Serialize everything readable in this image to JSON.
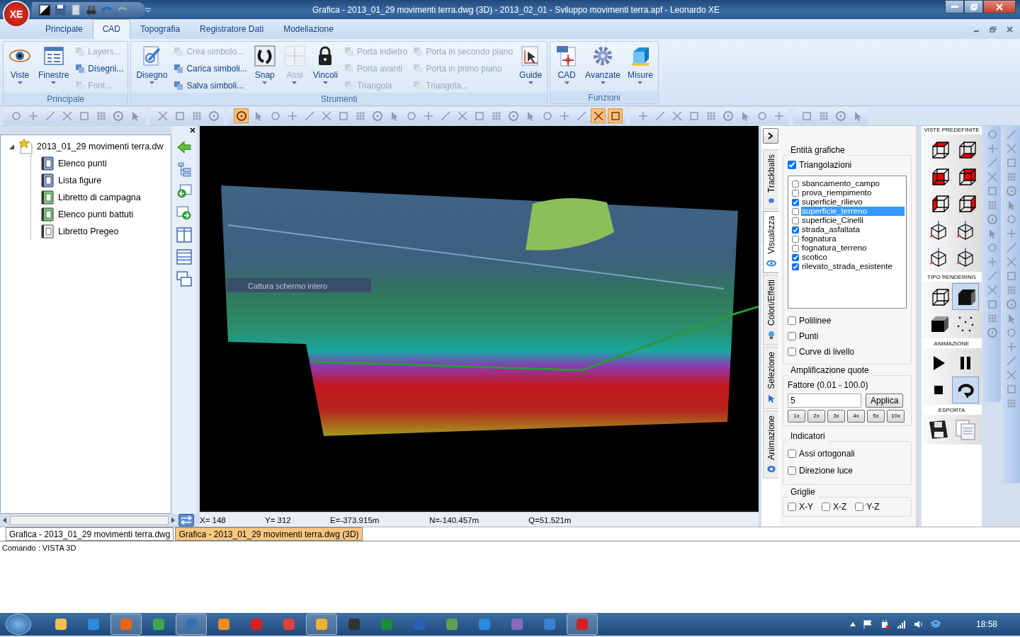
{
  "title_bar": {
    "title": "Grafica - 2013_01_29 movimenti terra.dwg (3D) - 2013_02_01 - Sviluppo movimenti terra.apf - Leonardo XE"
  },
  "app_button": {
    "label": "XE"
  },
  "ribbon": {
    "tabs": [
      {
        "label": "Principale",
        "selected": false
      },
      {
        "label": "CAD",
        "selected": true
      },
      {
        "label": "Topografia",
        "selected": false
      },
      {
        "label": "Registratore Dati",
        "selected": false
      },
      {
        "label": "Modellazione",
        "selected": false
      }
    ],
    "groups": [
      {
        "label": "Principale",
        "items": [
          {
            "kind": "large",
            "label": "Viste",
            "disabled": false
          },
          {
            "kind": "large",
            "label": "Finestre",
            "disabled": false
          },
          {
            "kind": "small",
            "label": "Layers...",
            "disabled": true
          },
          {
            "kind": "small",
            "label": "Disegni...",
            "disabled": false
          },
          {
            "kind": "small",
            "label": "Font...",
            "disabled": true
          }
        ]
      },
      {
        "label": "Strumenti",
        "items": [
          {
            "kind": "large",
            "label": "Disegno",
            "disabled": false
          },
          {
            "kind": "small",
            "label": "Crea simbolo...",
            "disabled": true
          },
          {
            "kind": "small",
            "label": "Carica simboli...",
            "disabled": false
          },
          {
            "kind": "small",
            "label": "Salva simboli...",
            "disabled": false
          },
          {
            "kind": "large",
            "label": "Snap",
            "disabled": false
          },
          {
            "kind": "large",
            "label": "Assi",
            "disabled": true
          },
          {
            "kind": "large",
            "label": "Vincoli",
            "disabled": false
          },
          {
            "kind": "small",
            "label": "Porta indietro",
            "disabled": true
          },
          {
            "kind": "small",
            "label": "Porta avanti",
            "disabled": true
          },
          {
            "kind": "small",
            "label": "Triangola",
            "disabled": true
          },
          {
            "kind": "small",
            "label": "Porta in secondo piano",
            "disabled": true
          },
          {
            "kind": "small",
            "label": "Porta in primo piano",
            "disabled": true
          },
          {
            "kind": "small",
            "label": "Triangola...",
            "disabled": true
          },
          {
            "kind": "large",
            "label": "Guide",
            "disabled": false
          }
        ]
      },
      {
        "label": "Funzioni",
        "items": [
          {
            "kind": "large",
            "label": "CAD",
            "disabled": false
          },
          {
            "kind": "large",
            "label": "Avanzate",
            "disabled": false
          },
          {
            "kind": "large",
            "label": "Misure",
            "disabled": false
          }
        ]
      }
    ]
  },
  "toolbars": [
    {
      "buttons": [
        {
          "pressed": false
        },
        {
          "pressed": false
        },
        {
          "pressed": false
        },
        {
          "pressed": false
        },
        {
          "pressed": false
        },
        {
          "pressed": false
        },
        {
          "pressed": false
        },
        {
          "pressed": false
        }
      ]
    },
    {
      "buttons": [
        {
          "pressed": false
        },
        {
          "pressed": false
        },
        {
          "pressed": false
        },
        {
          "pressed": false
        }
      ]
    },
    {
      "buttons": [
        {
          "pressed": true
        },
        {
          "pressed": false
        },
        {
          "pressed": false
        },
        {
          "pressed": false
        },
        {
          "pressed": false
        },
        {
          "pressed": false
        },
        {
          "pressed": false
        },
        {
          "pressed": false
        },
        {
          "pressed": false
        },
        {
          "pressed": false
        },
        {
          "pressed": false
        },
        {
          "pressed": false
        },
        {
          "pressed": false
        },
        {
          "pressed": false
        },
        {
          "pressed": false
        },
        {
          "pressed": false
        },
        {
          "pressed": false
        },
        {
          "pressed": false
        },
        {
          "pressed": false
        },
        {
          "pressed": false
        },
        {
          "pressed": false
        },
        {
          "pressed": true
        },
        {
          "pressed": true
        }
      ]
    },
    {
      "buttons": [
        {
          "pressed": false
        },
        {
          "pressed": false
        },
        {
          "pressed": false
        },
        {
          "pressed": false
        },
        {
          "pressed": false
        },
        {
          "pressed": false
        },
        {
          "pressed": false
        },
        {
          "pressed": false
        },
        {
          "pressed": false
        }
      ]
    },
    {
      "buttons": [
        {
          "pressed": false
        },
        {
          "pressed": false
        },
        {
          "pressed": false
        },
        {
          "pressed": false
        }
      ]
    }
  ],
  "tree": {
    "label": "2013_01_29 movimenti terra.dw",
    "expanded": true,
    "children": [
      {
        "label": "Elenco punti"
      },
      {
        "label": "Lista figure"
      },
      {
        "label": "Libretto di campagna"
      },
      {
        "label": "Elenco punti battuti"
      },
      {
        "label": "Libretto Pregeo"
      }
    ]
  },
  "viewport": {
    "hint": "Cattura schermo intero"
  },
  "side_tabs": [
    {
      "label": "Trackballs",
      "selected": false
    },
    {
      "label": "Visualizza",
      "selected": true
    },
    {
      "label": "Colori/Effetti",
      "selected": false
    },
    {
      "label": "Selezione",
      "selected": false
    },
    {
      "label": "Animazione",
      "selected": false
    }
  ],
  "view_panel": {
    "entities": {
      "title": "Entità grafiche",
      "triangulations": {
        "label": "Triangolazioni",
        "checked": true
      },
      "layers": [
        {
          "label": "sbancamento_campo",
          "checked": false,
          "selected": false
        },
        {
          "label": "prova_riempimento",
          "checked": false,
          "selected": false
        },
        {
          "label": "superficie_rilievo",
          "checked": true,
          "selected": false
        },
        {
          "label": "superficie_terreno",
          "checked": false,
          "selected": true
        },
        {
          "label": "superficie_Cinelli",
          "checked": false,
          "selected": false
        },
        {
          "label": "strada_asfaltata",
          "checked": true,
          "selected": false
        },
        {
          "label": "fognatura",
          "checked": false,
          "selected": false
        },
        {
          "label": "fognatura_terreno",
          "checked": false,
          "selected": false
        },
        {
          "label": "scotico",
          "checked": true,
          "selected": false
        },
        {
          "label": "rilevato_strada_esistente",
          "checked": true,
          "selected": false
        }
      ],
      "options": [
        {
          "label": "Polilinee",
          "checked": false
        },
        {
          "label": "Punti",
          "checked": false
        },
        {
          "label": "Curve di livello",
          "checked": false
        }
      ]
    },
    "amplification": {
      "title": "Amplificazione quote",
      "factor_label": "Fattore (0.01 - 100.0)",
      "value": "5",
      "apply_button": "Applica",
      "presets": [
        "1x",
        "2x",
        "3x",
        "4x",
        "5x",
        "10x"
      ]
    },
    "indicators": {
      "title": "Indicatori",
      "options": [
        {
          "label": "Assi ortogonali",
          "checked": false
        },
        {
          "label": "Direzione luce",
          "checked": false
        }
      ]
    },
    "grids": {
      "title": "Griglie",
      "options": [
        {
          "label": "X-Y",
          "checked": false
        },
        {
          "label": "X-Z",
          "checked": false
        },
        {
          "label": "Y-Z",
          "checked": false
        }
      ]
    }
  },
  "presets_panel": [
    {
      "title": "VISTE PREDEFINITE",
      "buttons": [
        {
          "selected": false
        },
        {
          "selected": false
        },
        {
          "selected": false
        },
        {
          "selected": false
        },
        {
          "selected": false
        },
        {
          "selected": false
        },
        {
          "selected": false
        },
        {
          "selected": false
        },
        {
          "selected": false
        },
        {
          "selected": false
        }
      ]
    },
    {
      "title": "TIPO RENDERING",
      "buttons": [
        {
          "selected": false
        },
        {
          "selected": true
        },
        {
          "selected": false
        },
        {
          "selected": false
        }
      ]
    },
    {
      "title": "ANIMAZIONE",
      "buttons": [
        {
          "selected": false
        },
        {
          "selected": false
        },
        {
          "selected": false
        },
        {
          "selected": true
        }
      ]
    },
    {
      "title": "ESPORTA",
      "buttons": [
        {
          "selected": false
        },
        {
          "selected": false
        }
      ]
    }
  ],
  "status_bar": {
    "fields": [
      "X= 148",
      "Y= 312",
      "E=-373.915m",
      "N=-140.457m",
      "Q=51.521m"
    ]
  },
  "doc_tabs": [
    {
      "label": "Grafica - 2013_01_29 movimenti terra.dwg",
      "selected": false
    },
    {
      "label": "Grafica - 2013_01_29 movimenti terra.dwg (3D)",
      "selected": true
    }
  ],
  "command": {
    "text": "Comando : VISTA 3D"
  },
  "taskbar": {
    "apps": [
      {
        "active": false
      },
      {
        "active": false
      },
      {
        "active": true
      },
      {
        "active": false
      },
      {
        "active": true
      },
      {
        "active": false
      },
      {
        "active": false
      },
      {
        "active": false
      },
      {
        "active": true
      },
      {
        "active": false
      },
      {
        "active": false
      },
      {
        "active": false
      },
      {
        "active": false
      },
      {
        "active": false
      },
      {
        "active": false
      },
      {
        "active": false
      },
      {
        "active": true
      }
    ],
    "clock": "18:58"
  }
}
